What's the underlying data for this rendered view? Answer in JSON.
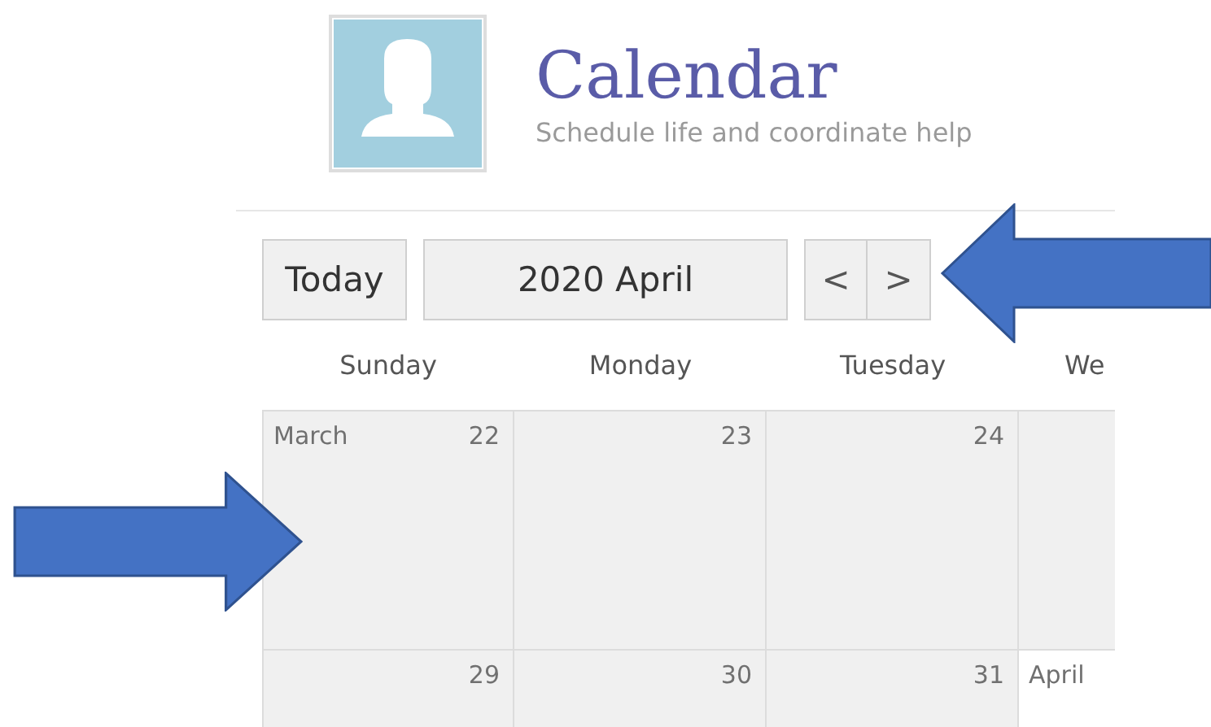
{
  "header": {
    "title": "Calendar",
    "subtitle": "Schedule life and coordinate help"
  },
  "toolbar": {
    "today": "Today",
    "period": "2020 April",
    "prev": "<",
    "next": ">"
  },
  "weekdays": [
    "Sunday",
    "Monday",
    "Tuesday",
    "We"
  ],
  "weeks": [
    [
      {
        "month": "March",
        "day": "22",
        "in_month": false
      },
      {
        "day": "23",
        "in_month": false
      },
      {
        "day": "24",
        "in_month": false
      },
      {
        "in_month": false
      }
    ],
    [
      {
        "day": "29",
        "in_month": false
      },
      {
        "day": "30",
        "in_month": false
      },
      {
        "day": "31",
        "in_month": false
      },
      {
        "month": "April",
        "in_month": true
      }
    ]
  ],
  "callouts": [
    {
      "kind": "left"
    },
    {
      "kind": "right"
    }
  ]
}
